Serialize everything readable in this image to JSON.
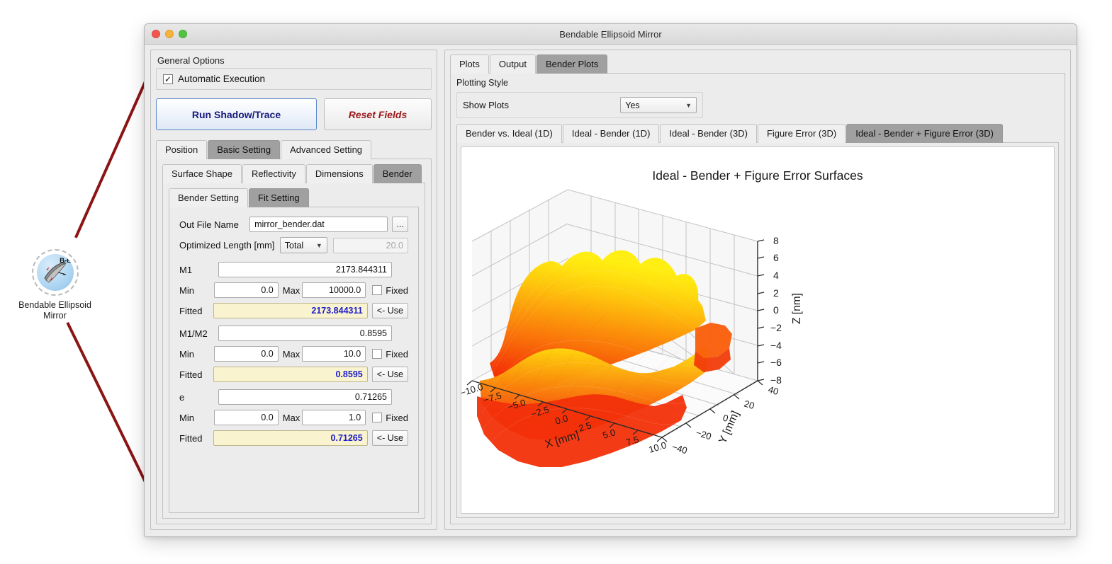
{
  "desktop": {
    "icon_name": "bendable-ellipsoid-mirror-icon",
    "icon_badge": "B-E",
    "icon_label_line1": "Bendable Ellipsoid",
    "icon_label_line2": "Mirror"
  },
  "window": {
    "title": "Bendable Ellipsoid Mirror"
  },
  "left": {
    "general_options_title": "General Options",
    "automatic_execution_label": "Automatic Execution",
    "automatic_execution_checked": "✓",
    "run_button_label": "Run Shadow/Trace",
    "reset_button_label": "Reset Fields",
    "tabs_level1": [
      {
        "label": "Position",
        "active": false
      },
      {
        "label": "Basic Setting",
        "active": true
      },
      {
        "label": "Advanced Setting",
        "active": false
      }
    ],
    "tabs_level2": [
      {
        "label": "Surface Shape",
        "active": false
      },
      {
        "label": "Reflectivity",
        "active": false
      },
      {
        "label": "Dimensions",
        "active": false
      },
      {
        "label": "Bender",
        "active": true
      }
    ],
    "tabs_level3": [
      {
        "label": "Bender Setting",
        "active": false
      },
      {
        "label": "Fit Setting",
        "active": true
      }
    ],
    "form": {
      "out_file_label": "Out File Name",
      "out_file_value": "mirror_bender.dat",
      "browse_button_label": "...",
      "optimized_length_label": "Optimized Length  [mm]",
      "optimized_length_select": "Total",
      "optimized_length_value": "20.0",
      "min_label": "Min",
      "max_label": "Max",
      "fitted_label": "Fitted",
      "fixed_label": "Fixed",
      "use_button_label": "<- Use",
      "params": [
        {
          "name": "M1",
          "value": "2173.844311",
          "min": "0.0",
          "max": "10000.0",
          "fixed": false,
          "fitted": "2173.844311"
        },
        {
          "name": "M1/M2",
          "value": "0.8595",
          "min": "0.0",
          "max": "10.0",
          "fixed": false,
          "fitted": "0.8595"
        },
        {
          "name": "e",
          "value": "0.71265",
          "min": "0.0",
          "max": "1.0",
          "fixed": false,
          "fitted": "0.71265"
        }
      ]
    }
  },
  "right": {
    "tabs_main": [
      {
        "label": "Plots",
        "active": false
      },
      {
        "label": "Output",
        "active": false
      },
      {
        "label": "Bender Plots",
        "active": true
      }
    ],
    "plotting_style_title": "Plotting Style",
    "show_plots_label": "Show Plots",
    "show_plots_value": "Yes",
    "tabs_plots": [
      {
        "label": "Bender vs. Ideal (1D)",
        "active": false
      },
      {
        "label": "Ideal - Bender (1D)",
        "active": false
      },
      {
        "label": "Ideal - Bender (3D)",
        "active": false
      },
      {
        "label": "Figure Error (3D)",
        "active": false
      },
      {
        "label": "Ideal - Bender + Figure Error (3D)",
        "active": true
      }
    ]
  },
  "chart_data": {
    "type": "surface3d",
    "title": "Ideal - Bender + Figure Error Surfaces",
    "xlabel": "X [mm]",
    "ylabel": "Y [mm]",
    "zlabel": "Z [nm]",
    "xticks": [
      "−10.0",
      "−7.5",
      "−5.0",
      "−2.5",
      "0.0",
      "2.5",
      "5.0",
      "7.5",
      "10.0"
    ],
    "yticks": [
      "−40",
      "−20",
      "0",
      "20",
      "40"
    ],
    "zticks": [
      "−8",
      "−6",
      "−4",
      "−2",
      "0",
      "2",
      "4",
      "6",
      "8"
    ],
    "xlim": [
      -10.0,
      10.0
    ],
    "ylim": [
      -40,
      40
    ],
    "zlim": [
      -8,
      8
    ],
    "colormap": "autumn",
    "colormap_low": "#ee2211",
    "colormap_high": "#ffee11",
    "grid": true,
    "legend": "none"
  },
  "colors": {
    "accent_blue": "#16197a",
    "reset_red": "#9c1616",
    "fitted_bg": "#faf3cf",
    "fitted_text": "#1e1ecb",
    "tab_active": "#a0a0a0",
    "connector": "#8b1414"
  }
}
